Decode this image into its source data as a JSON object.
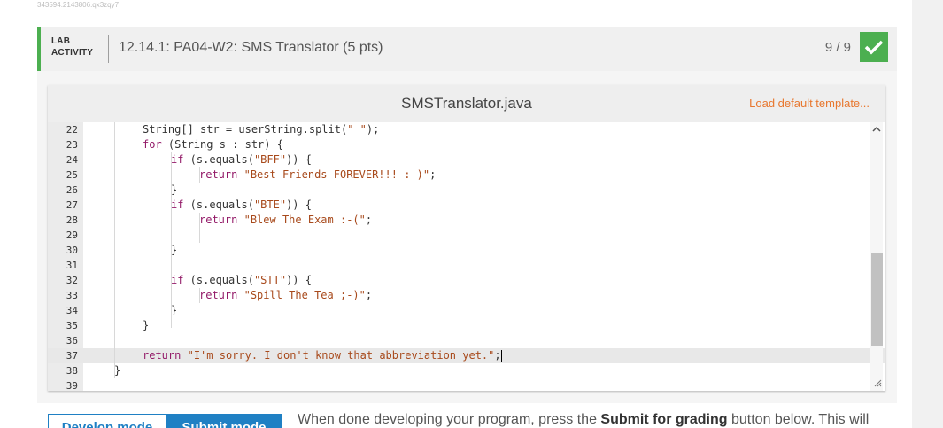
{
  "ref_id": "343594.2143806.qx3zqy7",
  "lab": {
    "type_line1": "LAB",
    "type_line2": "ACTIVITY",
    "title": "12.14.1: PA04-W2: SMS Translator (5 pts)",
    "score": "9 / 9",
    "status_icon": "checkmark-icon",
    "accent_color": "#4caf50"
  },
  "editor": {
    "file_name": "SMSTranslator.java",
    "load_template_label": "Load default template...",
    "lines": [
      {
        "n": "22",
        "segments": [
          {
            "t": "String[] str = userString.split(",
            "c": ""
          },
          {
            "t": "\" \"",
            "c": "str"
          },
          {
            "t": ");",
            "c": ""
          }
        ]
      },
      {
        "n": "23",
        "segments": [
          {
            "t": "for",
            "c": "kw"
          },
          {
            "t": " (String s : str) {",
            "c": ""
          }
        ]
      },
      {
        "n": "24",
        "segments": [
          {
            "t": "if",
            "c": "kw"
          },
          {
            "t": " (s.equals(",
            "c": ""
          },
          {
            "t": "\"BFF\"",
            "c": "str"
          },
          {
            "t": ")) {",
            "c": ""
          }
        ]
      },
      {
        "n": "25",
        "segments": [
          {
            "t": "return",
            "c": "kw"
          },
          {
            "t": " ",
            "c": ""
          },
          {
            "t": "\"Best Friends FOREVER!!! :-)\"",
            "c": "str"
          },
          {
            "t": ";",
            "c": ""
          }
        ]
      },
      {
        "n": "26",
        "segments": [
          {
            "t": "}",
            "c": ""
          }
        ]
      },
      {
        "n": "27",
        "segments": [
          {
            "t": "if",
            "c": "kw"
          },
          {
            "t": " (s.equals(",
            "c": ""
          },
          {
            "t": "\"BTE\"",
            "c": "str"
          },
          {
            "t": ")) {",
            "c": ""
          }
        ]
      },
      {
        "n": "28",
        "segments": [
          {
            "t": "return",
            "c": "kw"
          },
          {
            "t": " ",
            "c": ""
          },
          {
            "t": "\"Blew The Exam :-(\"",
            "c": "str"
          },
          {
            "t": ";",
            "c": ""
          }
        ]
      },
      {
        "n": "29",
        "segments": []
      },
      {
        "n": "30",
        "segments": [
          {
            "t": "}",
            "c": ""
          }
        ]
      },
      {
        "n": "31",
        "segments": []
      },
      {
        "n": "32",
        "segments": [
          {
            "t": "if",
            "c": "kw"
          },
          {
            "t": " (s.equals(",
            "c": ""
          },
          {
            "t": "\"STT\"",
            "c": "str"
          },
          {
            "t": ")) {",
            "c": ""
          }
        ]
      },
      {
        "n": "33",
        "segments": [
          {
            "t": "return",
            "c": "kw"
          },
          {
            "t": " ",
            "c": ""
          },
          {
            "t": "\"Spill The Tea ;-)\"",
            "c": "str"
          },
          {
            "t": ";",
            "c": ""
          }
        ]
      },
      {
        "n": "34",
        "segments": [
          {
            "t": "}",
            "c": ""
          }
        ]
      },
      {
        "n": "35",
        "segments": [
          {
            "t": "}",
            "c": ""
          }
        ]
      },
      {
        "n": "36",
        "segments": []
      },
      {
        "n": "37",
        "segments": [
          {
            "t": "return",
            "c": "kw"
          },
          {
            "t": " ",
            "c": ""
          },
          {
            "t": "\"I'm sorry. I don't know that abbreviation yet.\"",
            "c": "str"
          },
          {
            "t": ";",
            "c": ""
          }
        ]
      },
      {
        "n": "38",
        "segments": [
          {
            "t": "}",
            "c": ""
          }
        ]
      },
      {
        "n": "39",
        "segments": []
      }
    ],
    "active_line": "37"
  },
  "modes": {
    "develop_label": "Develop mode",
    "submit_label": "Submit mode",
    "selected": "Submit mode"
  },
  "instructions": {
    "prefix": "When done developing your program, press the ",
    "bold": "Submit for grading",
    "suffix": " button below. This will"
  }
}
